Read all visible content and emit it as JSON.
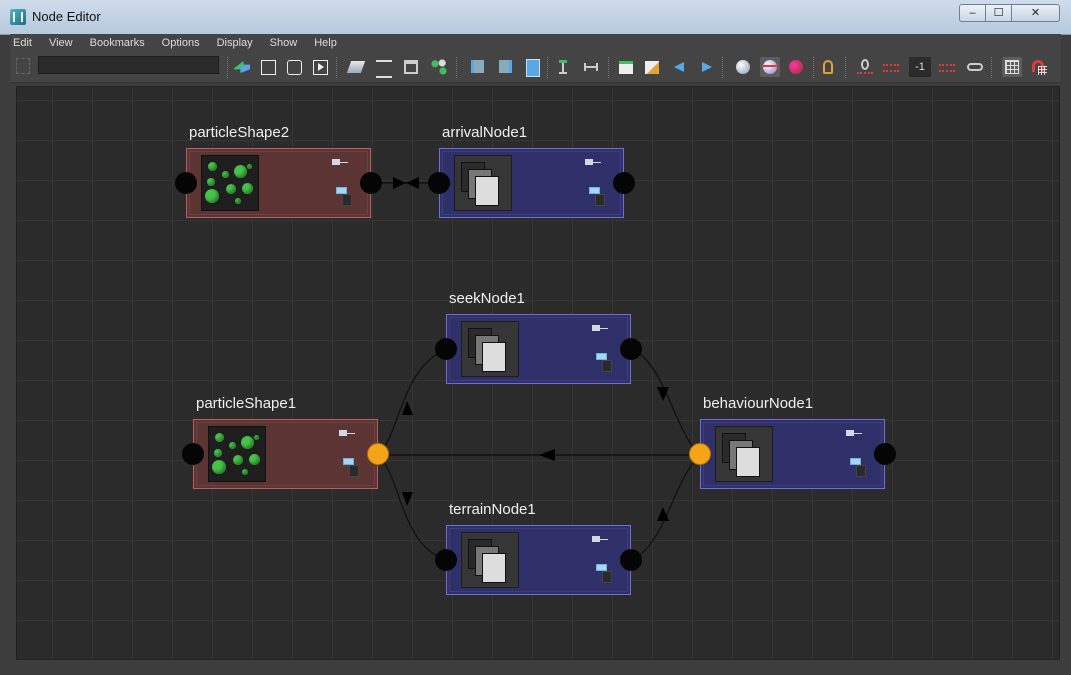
{
  "window": {
    "title": "Node Editor",
    "controls": {
      "minimize": "‒",
      "maximize": "☐",
      "close": "✕"
    }
  },
  "menu": [
    "Edit",
    "View",
    "Bookmarks",
    "Options",
    "Display",
    "Show",
    "Help"
  ],
  "toolbar": {
    "search_value": "",
    "zoom_value": "-1",
    "icons": [
      "grip-icon",
      "graph-swap-icon",
      "frame-all-icon",
      "frame-selected-icon",
      "play-icon",
      "clear-graph-icon",
      "add-selected-icon",
      "remove-selected-icon",
      "graph-layout-icon",
      "input-connections-icon",
      "output-connections-icon",
      "input-output-icon",
      "pin-selected-icon",
      "unpin-icon",
      "add-bookmark-icon",
      "edit-bookmark-icon",
      "previous-bookmark-icon",
      "next-bookmark-icon",
      "show-shapes-icon",
      "show-shaders-icon",
      "show-materials-icon",
      "lock-icon",
      "simple-mode-icon",
      "connected-mode-icon",
      "zoom-icon",
      "all-attributes-icon",
      "grid-toggle-icon",
      "snap-icon"
    ],
    "accent_colors": {
      "green": "#3fbf61",
      "blue": "#5aa7e6",
      "red": "#e23a3a"
    }
  },
  "graph": {
    "nodes": [
      {
        "id": "particleShape2",
        "label": "particleShape2",
        "type": "shape"
      },
      {
        "id": "arrivalNode1",
        "label": "arrivalNode1",
        "type": "dependency"
      },
      {
        "id": "seekNode1",
        "label": "seekNode1",
        "type": "dependency"
      },
      {
        "id": "particleShape1",
        "label": "particleShape1",
        "type": "shape"
      },
      {
        "id": "behaviourNode1",
        "label": "behaviourNode1",
        "type": "dependency"
      },
      {
        "id": "terrainNode1",
        "label": "terrainNode1",
        "type": "dependency"
      }
    ],
    "connections": [
      {
        "from": "arrivalNode1",
        "to": "particleShape2"
      },
      {
        "from": "particleShape1",
        "to": "seekNode1"
      },
      {
        "from": "particleShape1",
        "to": "terrainNode1"
      },
      {
        "from": "seekNode1",
        "to": "behaviourNode1"
      },
      {
        "from": "terrainNode1",
        "to": "behaviourNode1"
      },
      {
        "from": "behaviourNode1",
        "to": "particleShape1"
      }
    ],
    "colors": {
      "shape_node": "#5c3434",
      "dependency_node": "#2f2f6a",
      "active_port": "#f4a418",
      "port": "#050505",
      "particle": "#49c24a"
    }
  }
}
